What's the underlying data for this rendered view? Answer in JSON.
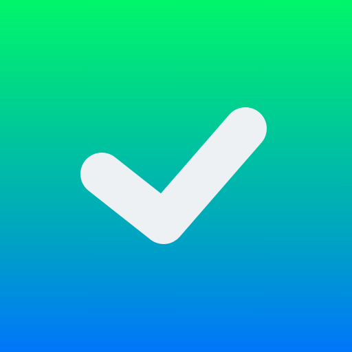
{
  "icon": {
    "name": "check-icon",
    "gradient_top": "#00f66a",
    "gradient_mid": "#00a3c3",
    "gradient_bottom": "#0076fb",
    "check_color": "#eef1f3"
  }
}
